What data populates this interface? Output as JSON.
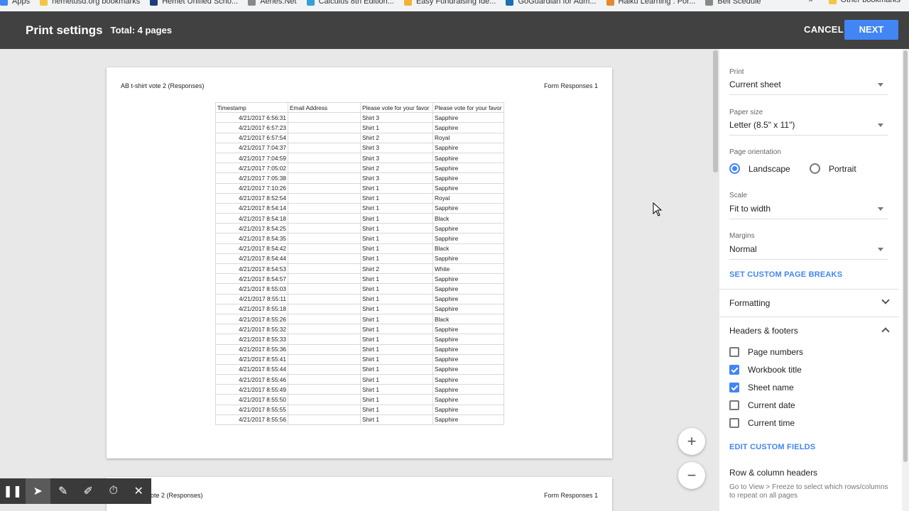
{
  "bookmarks": {
    "items": [
      {
        "label": "Apps",
        "icon": "apps-icon",
        "color": "#4285f4"
      },
      {
        "label": "hemetusd.org bookmarks",
        "icon": "folder-icon",
        "color": "#f4c542"
      },
      {
        "label": "Hemet Unified Scho...",
        "icon": "site-icon",
        "color": "#1a3e7a"
      },
      {
        "label": "Aeries.Net",
        "icon": "page-icon",
        "color": "#888888"
      },
      {
        "label": "Calculus 8th Edition...",
        "icon": "site-icon",
        "color": "#34a0d8"
      },
      {
        "label": "Easy Fundraising Ide...",
        "icon": "site-icon",
        "color": "#f2b233"
      },
      {
        "label": "GoGuardian for Adm...",
        "icon": "site-icon",
        "color": "#1b6fb6"
      },
      {
        "label": "Haiku Learning : Por...",
        "icon": "site-icon",
        "color": "#e28b2b"
      },
      {
        "label": "Bell Scedule",
        "icon": "page-icon",
        "color": "#888888"
      }
    ],
    "overflow": "»",
    "other": "Other bookmarks"
  },
  "header": {
    "title": "Print settings",
    "total": "Total: 4 pages",
    "cancel": "CANCEL",
    "next": "NEXT"
  },
  "preview": {
    "workbook_title": "AB t-shirt vote 2 (Responses)",
    "sheet_name": "Form Responses 1",
    "page2_title": "ote 2 (Responses)",
    "page2_sheet": "Form Responses 1",
    "columns": [
      "Timestamp",
      "Email Address",
      "Please vote for your favor",
      "Please vote for your favor"
    ],
    "rows": [
      [
        "4/21/2017 6:56:31",
        "",
        "Shirt 3",
        "Sapphire"
      ],
      [
        "4/21/2017 6:57:23",
        "",
        "Shirt 1",
        "Sapphire"
      ],
      [
        "4/21/2017 6:57:54",
        "",
        "Shirt 2",
        "Royal"
      ],
      [
        "4/21/2017 7:04:37",
        "",
        "Shirt 3",
        "Sapphire"
      ],
      [
        "4/21/2017 7:04:59",
        "",
        "Shirt 3",
        "Sapphire"
      ],
      [
        "4/21/2017 7:05:02",
        "",
        "Shirt 2",
        "Sapphire"
      ],
      [
        "4/21/2017 7:05:38",
        "",
        "Shirt 3",
        "Sapphire"
      ],
      [
        "4/21/2017 7:10:26",
        "",
        "Shirt 1",
        "Sapphire"
      ],
      [
        "4/21/2017 8:52:54",
        "",
        "Shirt 1",
        "Royal"
      ],
      [
        "4/21/2017 8:54:14",
        "",
        "Shirt 1",
        "Sapphire"
      ],
      [
        "4/21/2017 8:54:18",
        "",
        "Shirt 1",
        "Black"
      ],
      [
        "4/21/2017 8:54:25",
        "",
        "Shirt 1",
        "Sapphire"
      ],
      [
        "4/21/2017 8:54:35",
        "",
        "Shirt 1",
        "Sapphire"
      ],
      [
        "4/21/2017 8:54:42",
        "",
        "Shirt 1",
        "Black"
      ],
      [
        "4/21/2017 8:54:44",
        "",
        "Shirt 1",
        "Sapphire"
      ],
      [
        "4/21/2017 8:54:53",
        "",
        "Shirt 2",
        "White"
      ],
      [
        "4/21/2017 8:54:57",
        "",
        "Shirt 1",
        "Sapphire"
      ],
      [
        "4/21/2017 8:55:03",
        "",
        "Shirt 1",
        "Sapphire"
      ],
      [
        "4/21/2017 8:55:11",
        "",
        "Shirt 1",
        "Sapphire"
      ],
      [
        "4/21/2017 8:55:18",
        "",
        "Shirt 1",
        "Sapphire"
      ],
      [
        "4/21/2017 8:55:26",
        "",
        "Shirt 1",
        "Black"
      ],
      [
        "4/21/2017 8:55:32",
        "",
        "Shirt 1",
        "Sapphire"
      ],
      [
        "4/21/2017 8:55:33",
        "",
        "Shirt 1",
        "Sapphire"
      ],
      [
        "4/21/2017 8:55:36",
        "",
        "Shirt 1",
        "Sapphire"
      ],
      [
        "4/21/2017 8:55:41",
        "",
        "Shirt 1",
        "Sapphire"
      ],
      [
        "4/21/2017 8:55:44",
        "",
        "Shirt 1",
        "Sapphire"
      ],
      [
        "4/21/2017 8:55:46",
        "",
        "Shirt 1",
        "Sapphire"
      ],
      [
        "4/21/2017 8:55:49",
        "",
        "Shirt 1",
        "Sapphire"
      ],
      [
        "4/21/2017 8:55:50",
        "",
        "Shirt 1",
        "Sapphire"
      ],
      [
        "4/21/2017 8:55:55",
        "",
        "Shirt 1",
        "Sapphire"
      ],
      [
        "4/21/2017 8:55:56",
        "",
        "Shirt 1",
        "Sapphire"
      ]
    ],
    "zoom_in": "+",
    "zoom_out": "−"
  },
  "panel": {
    "print_label": "Print",
    "print_value": "Current sheet",
    "paper_label": "Paper size",
    "paper_value": "Letter (8.5\" x 11\")",
    "orientation_label": "Page orientation",
    "orientation_options": [
      "Landscape",
      "Portrait"
    ],
    "orientation_selected": "Landscape",
    "scale_label": "Scale",
    "scale_value": "Fit to width",
    "margins_label": "Margins",
    "margins_value": "Normal",
    "custom_breaks": "SET CUSTOM PAGE BREAKS",
    "formatting": "Formatting",
    "headers_footers": "Headers & footers",
    "checkboxes": [
      {
        "label": "Page numbers",
        "checked": false
      },
      {
        "label": "Workbook title",
        "checked": true
      },
      {
        "label": "Sheet name",
        "checked": true
      },
      {
        "label": "Current date",
        "checked": false
      },
      {
        "label": "Current time",
        "checked": false
      }
    ],
    "edit_fields": "EDIT CUSTOM FIELDS",
    "row_col_headers": "Row & column headers",
    "freeze_note": "Go to View > Freeze to select which rows/columns to repeat on all pages"
  },
  "colors": {
    "accent": "#4285f4",
    "header_bg": "#414141",
    "preview_bg": "#e8e8e8"
  }
}
